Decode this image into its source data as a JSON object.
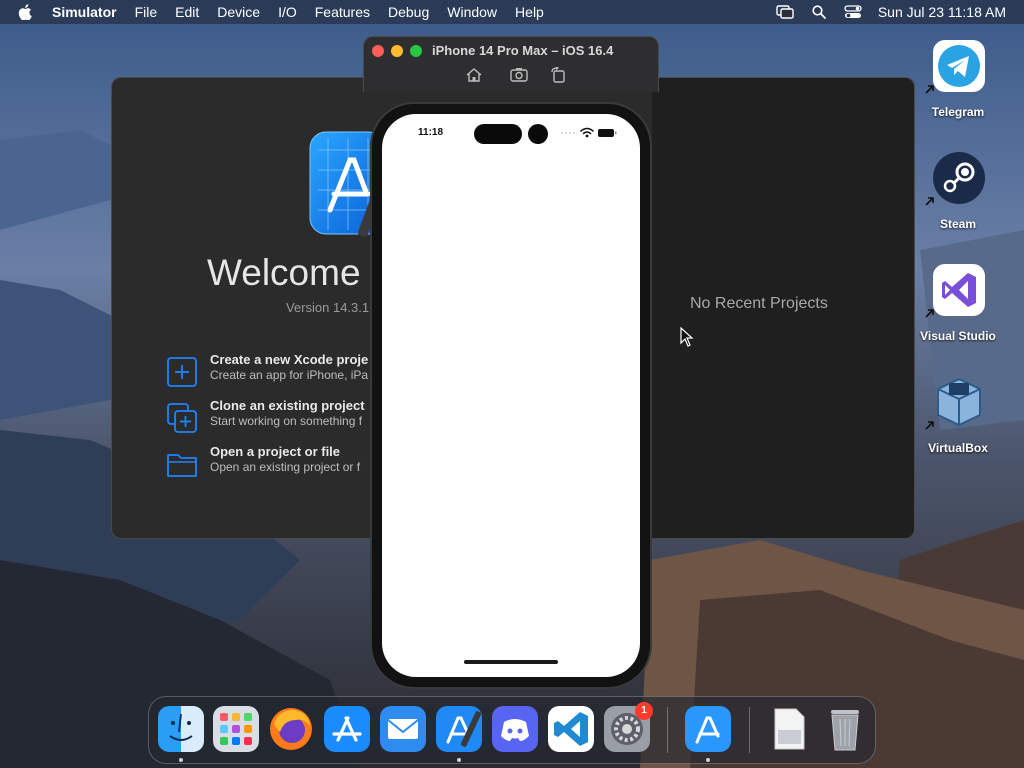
{
  "menubar": {
    "app_name": "Simulator",
    "items": [
      "File",
      "Edit",
      "Device",
      "I/O",
      "Features",
      "Debug",
      "Window",
      "Help"
    ],
    "clock": "Sun Jul 23  11:18 AM"
  },
  "xcode_welcome": {
    "title": "Welcome t",
    "version": "Version 14.3.1",
    "actions": [
      {
        "title": "Create a new Xcode proje",
        "subtitle": "Create an app for iPhone, iPa"
      },
      {
        "title": "Clone an existing project",
        "subtitle": "Start working on something f"
      },
      {
        "title": "Open a project or file",
        "subtitle": "Open an existing project or f"
      }
    ],
    "no_recent": "No Recent Projects"
  },
  "simulator": {
    "title": "iPhone 14 Pro Max – iOS 16.4",
    "status_time": "11:18"
  },
  "desktop": {
    "items": [
      {
        "label": "Telegram"
      },
      {
        "label": "Steam"
      },
      {
        "label": "Visual Studio"
      },
      {
        "label": "VirtualBox"
      }
    ]
  },
  "dock": {
    "apps": [
      "Finder",
      "Launchpad",
      "Firefox",
      "App Store",
      "Mail",
      "Xcode",
      "Discord",
      "Visual Studio Code",
      "System Settings",
      "Simulator",
      "Preview Document",
      "Trash"
    ],
    "settings_badge": "1"
  },
  "colors": {
    "menubar_bg": "#1e2230",
    "xcode_bg": "#2b2b2c",
    "accent_blue": "#1f84ff",
    "badge_red": "#ff3b30"
  }
}
